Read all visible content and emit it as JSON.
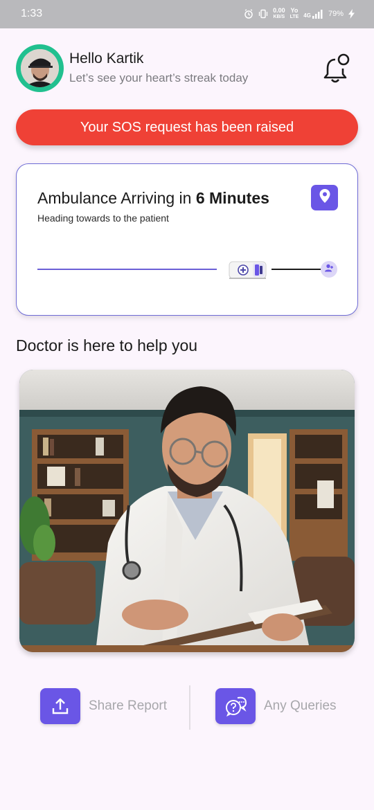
{
  "status_bar": {
    "time": "1:33",
    "speed_top": "0.00",
    "speed_unit": "KB/S",
    "network_top": "Yo",
    "network_bottom": "LTE",
    "signal_label": "4G",
    "battery": "79%"
  },
  "header": {
    "greeting": "Hello Kartik",
    "subtitle": "Let’s see your heart’s streak today"
  },
  "sos": {
    "label": "Your SOS request has been raised"
  },
  "ambulance": {
    "title_prefix": "Ambulance Arriving in",
    "title_time": "6 Minutes",
    "subtitle": "Heading towards to the patient",
    "progress": 0.78
  },
  "doctor": {
    "heading": "Doctor is here to help you"
  },
  "actions": {
    "share_label": "Share Report",
    "queries_label": "Any Queries"
  },
  "colors": {
    "accent": "#6a56e6",
    "sos": "#ef4136",
    "avatar_ring": "#21c08f",
    "background": "#fcf5fd"
  },
  "icons": [
    "alarm-icon",
    "vibrate-icon",
    "signal-icon",
    "battery-charging-icon",
    "bell-notification-icon",
    "location-pin-icon",
    "ambulance-icon",
    "person-pin-icon",
    "upload-icon",
    "chat-question-icon"
  ]
}
